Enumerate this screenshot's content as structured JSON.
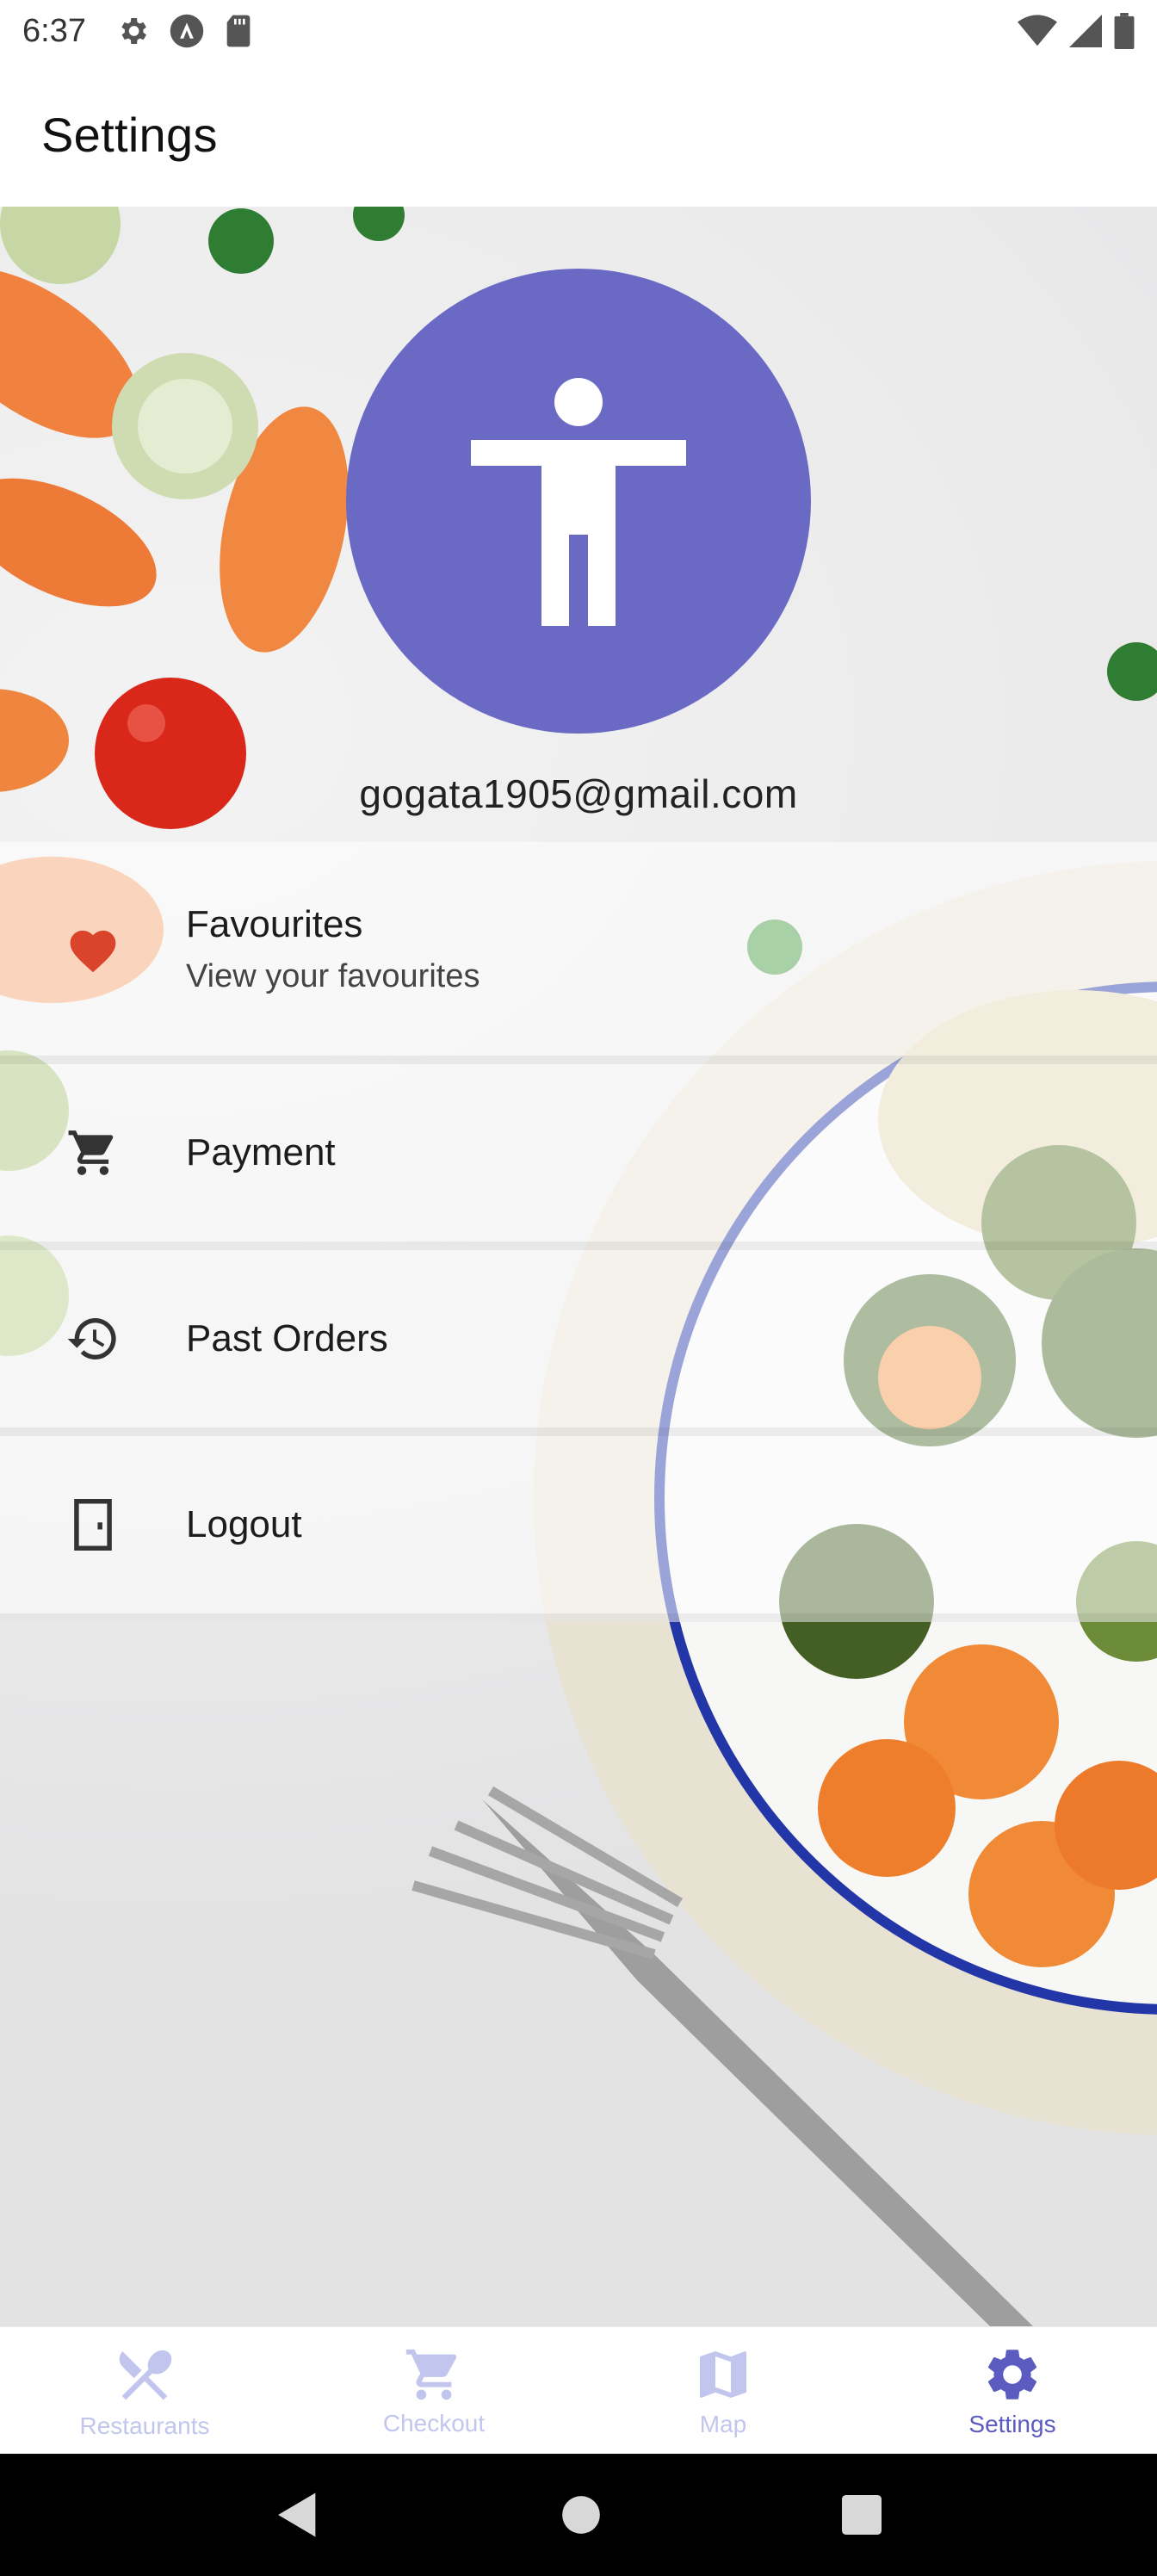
{
  "status_bar": {
    "time": "6:37",
    "left_icons": [
      "gear-icon",
      "a-circle-icon",
      "sd-card-icon"
    ],
    "right_icons": [
      "wifi-icon",
      "signal-icon",
      "battery-icon"
    ]
  },
  "app_bar": {
    "title": "Settings"
  },
  "profile": {
    "avatar_icon": "accessibility-person-icon",
    "avatar_color": "#6a6ac4",
    "email": "gogata1905@gmail.com"
  },
  "menu": {
    "items": [
      {
        "label": "Favourites",
        "sublabel": "View your favourites",
        "icon": "heart-icon",
        "icon_color": "#d9442b"
      },
      {
        "label": "Payment",
        "icon": "cart-icon"
      },
      {
        "label": "Past Orders",
        "icon": "history-icon"
      },
      {
        "label": "Logout",
        "icon": "door-icon"
      }
    ]
  },
  "bottom_nav": {
    "active_color": "#5b5bc0",
    "inactive_color": "#c2c6ee",
    "items": [
      {
        "label": "Restaurants",
        "icon": "utensils-icon",
        "active": false
      },
      {
        "label": "Checkout",
        "icon": "cart-icon",
        "active": false
      },
      {
        "label": "Map",
        "icon": "map-icon",
        "active": false
      },
      {
        "label": "Settings",
        "icon": "gear-icon",
        "active": true
      }
    ]
  },
  "system_nav": {
    "buttons": [
      "back-icon",
      "home-icon",
      "recents-icon"
    ]
  }
}
